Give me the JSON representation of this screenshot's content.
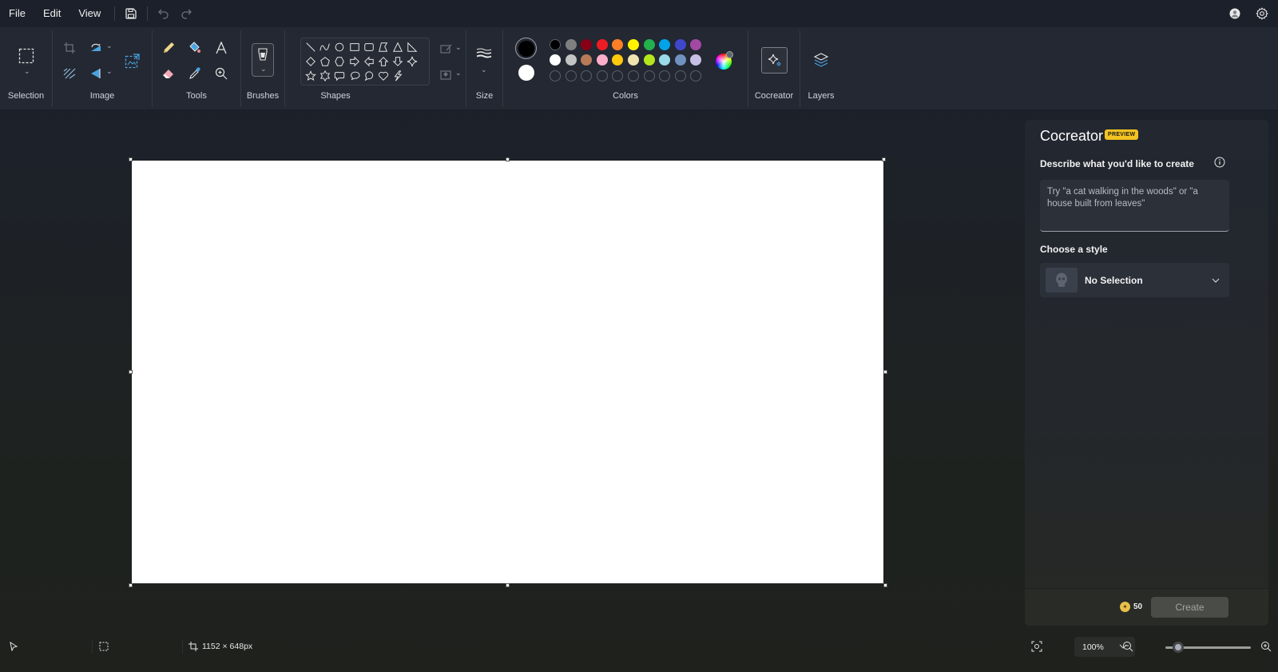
{
  "menubar": {
    "file": "File",
    "edit": "Edit",
    "view": "View",
    "icons": [
      "save-icon",
      "undo-icon",
      "redo-icon",
      "account-icon",
      "settings-icon"
    ]
  },
  "ribbon": {
    "groups": {
      "selection": "Selection",
      "image": "Image",
      "tools": "Tools",
      "brushes": "Brushes",
      "shapes": "Shapes",
      "size": "Size",
      "colors": "Colors",
      "cocreator": "Cocreator",
      "layers": "Layers"
    },
    "shapes": [
      "line",
      "curve",
      "oval",
      "rectangle",
      "rounded-rectangle",
      "polygon",
      "triangle",
      "right-triangle",
      "diamond",
      "pentagon",
      "hexagon",
      "right-arrow",
      "left-arrow",
      "up-arrow",
      "down-arrow",
      "four-point-star",
      "five-point-star",
      "six-point-star",
      "rounded-callout",
      "oval-callout",
      "cloud-callout",
      "heart",
      "lightning"
    ],
    "colors": {
      "primary": "#000000",
      "secondary": "#ffffff",
      "row1": [
        "#000000",
        "#7f7f7f",
        "#880015",
        "#ed1c24",
        "#ff7f27",
        "#fff200",
        "#22b14c",
        "#00a2e8",
        "#3f48cc",
        "#a349a4"
      ],
      "row2": [
        "#ffffff",
        "#c3c3c3",
        "#b97a57",
        "#ffaec9",
        "#ffc90e",
        "#efe4b0",
        "#b5e61d",
        "#99d9ea",
        "#7092be",
        "#c8bfe7"
      ],
      "custom_slots": 10
    }
  },
  "cocreator": {
    "title": "Cocreator",
    "badge": "PREVIEW",
    "describe_label": "Describe what you'd like to create",
    "prompt_placeholder": "Try \"a cat walking in the woods\" or \"a house built from leaves\"",
    "style_label": "Choose a style",
    "style_value": "No Selection",
    "credits": "50",
    "create_label": "Create"
  },
  "statusbar": {
    "canvas_size": "1152 × 648px",
    "zoom": "100%",
    "zoom_level_percent": 100
  }
}
